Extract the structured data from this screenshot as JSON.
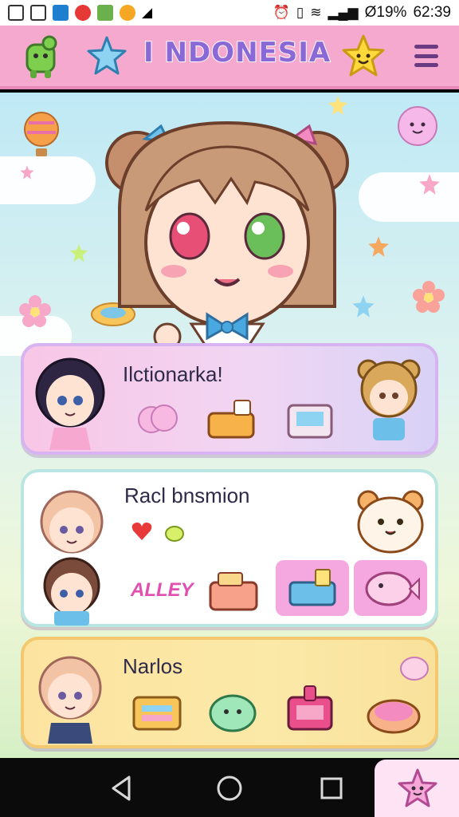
{
  "status_bar": {
    "battery": "Ø19%",
    "time": "62:39"
  },
  "header": {
    "title": "I NDONESIA"
  },
  "cards": [
    {
      "title": "Ilctionarka!"
    },
    {
      "title": "Racl bnsmion",
      "sticker_text": "ALLEY"
    },
    {
      "title": "Narlos"
    }
  ],
  "colors": {
    "header_bg": "#f6a9cf",
    "title_color": "#8a68d6",
    "card1_bg": "#f8c6e6",
    "card2_bg": "#ffffff",
    "card3_bg": "#fde3a0",
    "tile_pink": "#f5a7e0"
  },
  "icons": {
    "header_left": "frog-mascot-icon",
    "header_star": "star-icon",
    "header_right": "smiling-star-icon",
    "menu": "hamburger-menu-icon"
  }
}
